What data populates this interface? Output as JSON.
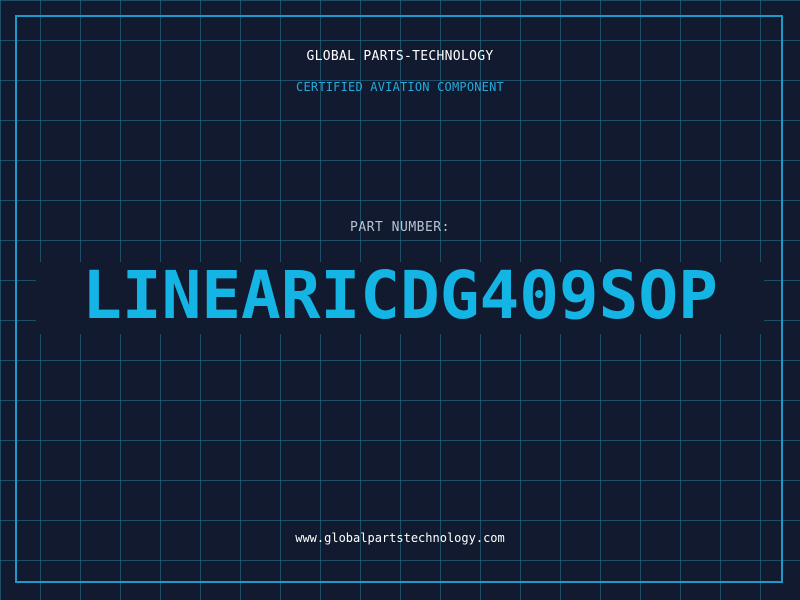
{
  "card": {
    "company": "GLOBAL PARTS-TECHNOLOGY",
    "subtitle": "CERTIFIED AVIATION COMPONENT",
    "part_label": "PART NUMBER:",
    "part_number": "LINEARICDG409SOP",
    "website": "www.globalpartstechnology.com"
  },
  "colors": {
    "background": "#111a2e",
    "grid": "#28789a",
    "frame": "#1f9ac8",
    "accent": "#14b4e4",
    "label": "#b7c4d4",
    "text": "#ffffff"
  }
}
